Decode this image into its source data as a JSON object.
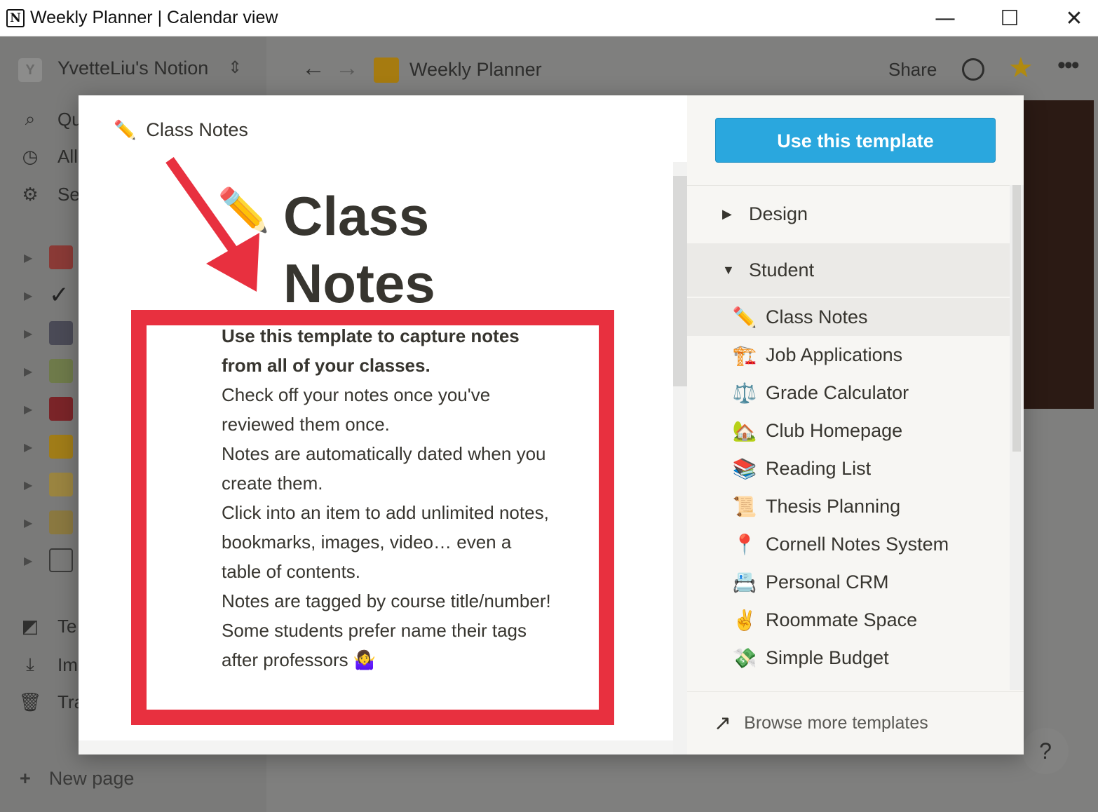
{
  "window": {
    "title": "Weekly Planner | Calendar view",
    "minimize": "—",
    "maximize": "☐",
    "close": "✕"
  },
  "topbar": {
    "workspace_initial": "Y",
    "workspace_name": "YvetteLiu's Notion",
    "breadcrumb": "Weekly Planner",
    "share_label": "Share"
  },
  "sidebar": {
    "items": [
      {
        "icon": "search-icon",
        "label": "Qu"
      },
      {
        "icon": "clock-icon",
        "label": "All"
      },
      {
        "icon": "gear-icon",
        "label": "Se"
      }
    ],
    "bottom_items": [
      {
        "icon": "templates-icon",
        "label": "Te"
      },
      {
        "icon": "import-icon",
        "label": "Im"
      },
      {
        "icon": "trash-icon",
        "label": "Tra"
      }
    ],
    "new_page": "New page"
  },
  "modal": {
    "preview": {
      "breadcrumb": "Class Notes",
      "title_line1": "Class",
      "title_line2": "Notes",
      "description": [
        "Use this template to capture notes from all of your classes.",
        "Check off your notes once you've reviewed them once.",
        "Notes are automatically dated when you create them.",
        "Click into an item to add unlimited notes, bookmarks, images, video… even a table of contents.",
        "Notes are tagged by course title/number!",
        "Some students prefer name their tags after professors 🤷‍♀️"
      ]
    },
    "panel": {
      "use_button": "Use this template",
      "categories": [
        {
          "label": "Design",
          "expanded": false
        },
        {
          "label": "Student",
          "expanded": true
        }
      ],
      "templates": [
        {
          "emoji": "✏️",
          "label": "Class Notes",
          "selected": true
        },
        {
          "emoji": "🏗️",
          "label": "Job Applications"
        },
        {
          "emoji": "⚖️",
          "label": "Grade Calculator"
        },
        {
          "emoji": "🏡",
          "label": "Club Homepage"
        },
        {
          "emoji": "📚",
          "label": "Reading List"
        },
        {
          "emoji": "📜",
          "label": "Thesis Planning"
        },
        {
          "emoji": "📍",
          "label": "Cornell Notes System"
        },
        {
          "emoji": "📇",
          "label": "Personal CRM"
        },
        {
          "emoji": "✌️",
          "label": "Roommate Space"
        },
        {
          "emoji": "💸",
          "label": "Simple Budget"
        }
      ],
      "browse_label": "Browse more templates"
    }
  },
  "colors": {
    "use_button": "#2aa7de",
    "highlight_box": "#e8303f",
    "overlay": "#7d7d7c"
  },
  "help_label": "?"
}
